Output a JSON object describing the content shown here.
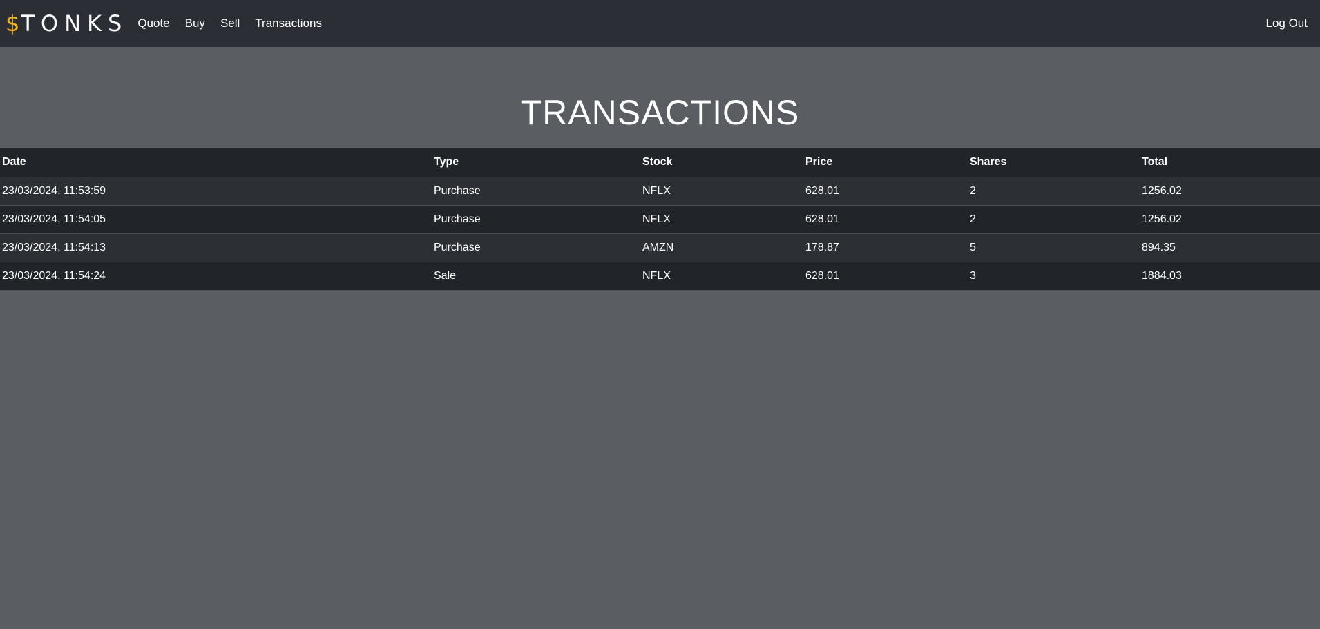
{
  "navbar": {
    "brand_symbol": "$",
    "brand_text": "TONKS",
    "links": [
      "Quote",
      "Buy",
      "Sell",
      "Transactions"
    ],
    "logout": "Log Out"
  },
  "page": {
    "title": "TRANSACTIONS"
  },
  "table": {
    "headers": [
      "Date",
      "Type",
      "Stock",
      "Price",
      "Shares",
      "Total"
    ],
    "rows": [
      [
        "23/03/2024, 11:53:59",
        "Purchase",
        "NFLX",
        "628.01",
        "2",
        "1256.02"
      ],
      [
        "23/03/2024, 11:54:05",
        "Purchase",
        "NFLX",
        "628.01",
        "2",
        "1256.02"
      ],
      [
        "23/03/2024, 11:54:13",
        "Purchase",
        "AMZN",
        "178.87",
        "5",
        "894.35"
      ],
      [
        "23/03/2024, 11:54:24",
        "Sale",
        "NFLX",
        "628.01",
        "3",
        "1884.03"
      ]
    ]
  },
  "colors": {
    "navbar_bg": "#2b2f35",
    "page_bg": "#5a5e62",
    "brand_accent": "#f0b429",
    "table_header_bg": "#212529"
  }
}
